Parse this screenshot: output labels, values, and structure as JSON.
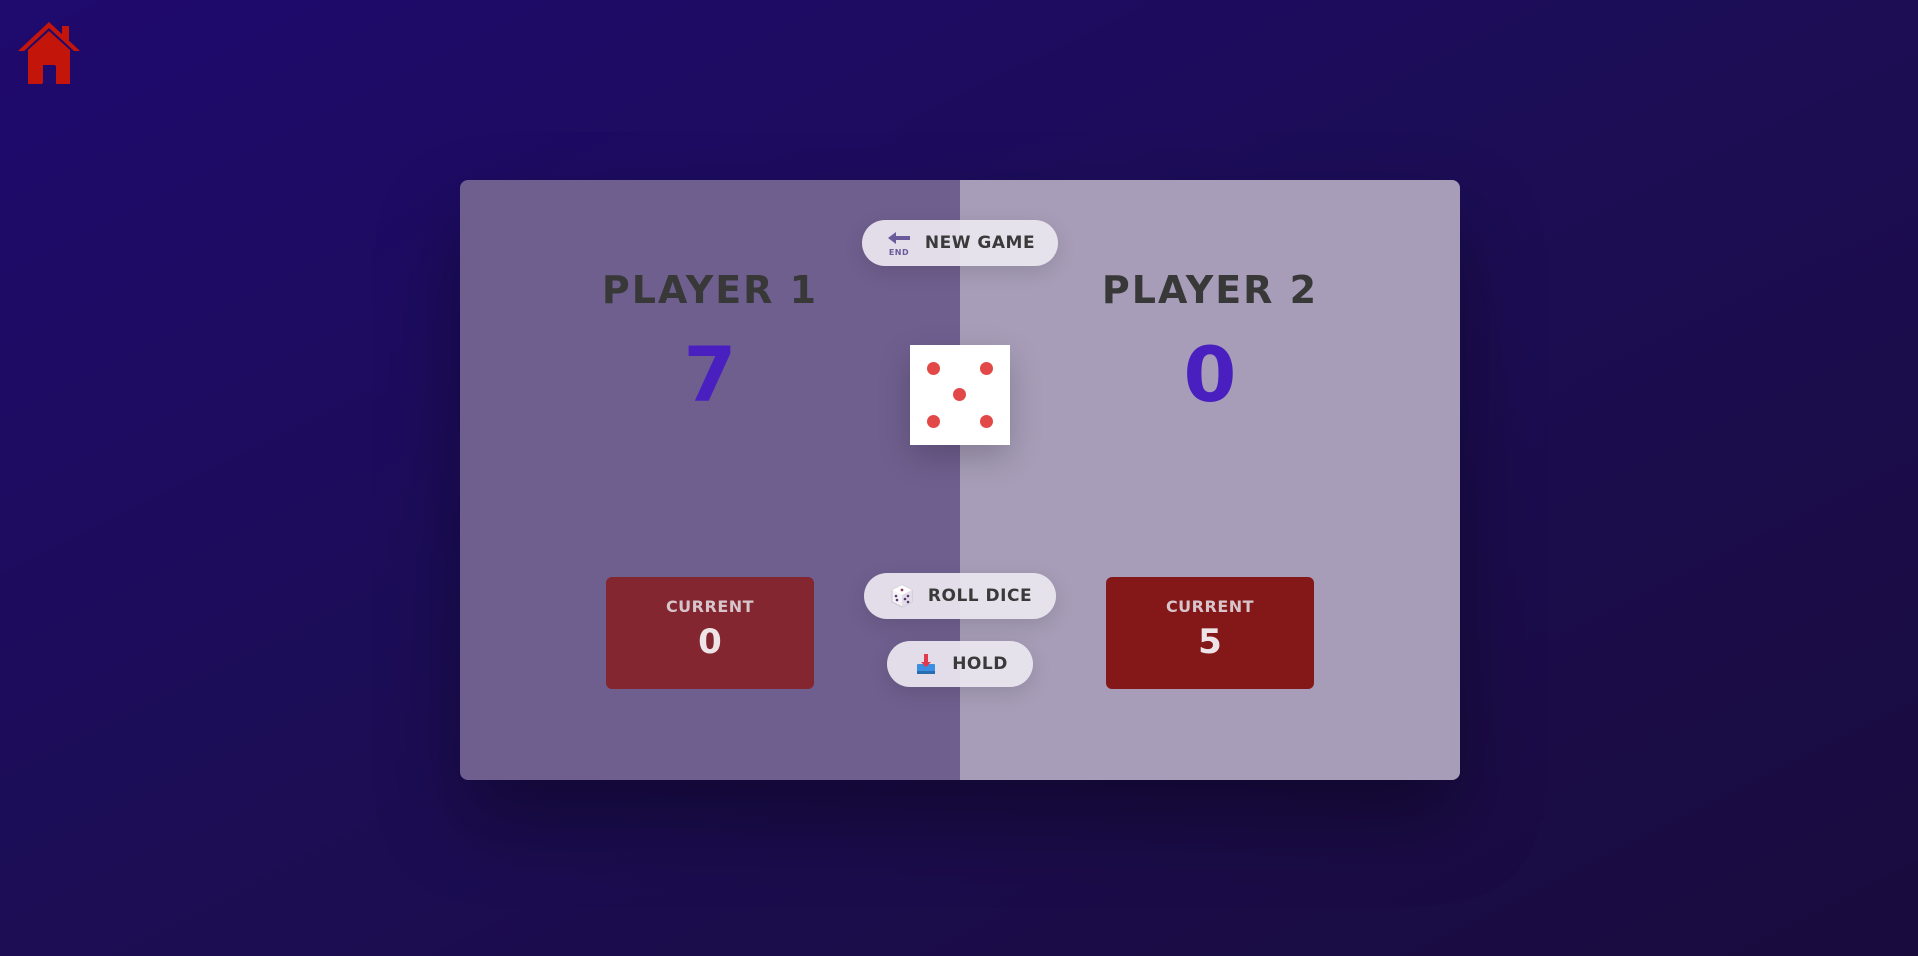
{
  "app": {
    "home_icon": "home-icon",
    "colors": {
      "background": "#1f0a6e",
      "player1_panel": "#6f5f8f",
      "player2_panel": "#a79db8",
      "score": "#4a1fc0",
      "current_box_player1": "#84262f",
      "current_box_player2": "#841818",
      "dice_pip": "#e24848",
      "home_icon": "#c4150b"
    }
  },
  "players": [
    {
      "name": "PLAYER 1",
      "score": "7",
      "current_label": "CURRENT",
      "current_value": "0"
    },
    {
      "name": "PLAYER 2",
      "score": "0",
      "current_label": "CURRENT",
      "current_value": "5"
    }
  ],
  "controls": {
    "new_game": {
      "label": "NEW GAME",
      "icon": "end-arrow-icon"
    },
    "roll_dice": {
      "label": "ROLL DICE",
      "icon": "dice-icon"
    },
    "hold": {
      "label": "HOLD",
      "icon": "hold-icon"
    }
  },
  "dice": {
    "value": 5
  }
}
